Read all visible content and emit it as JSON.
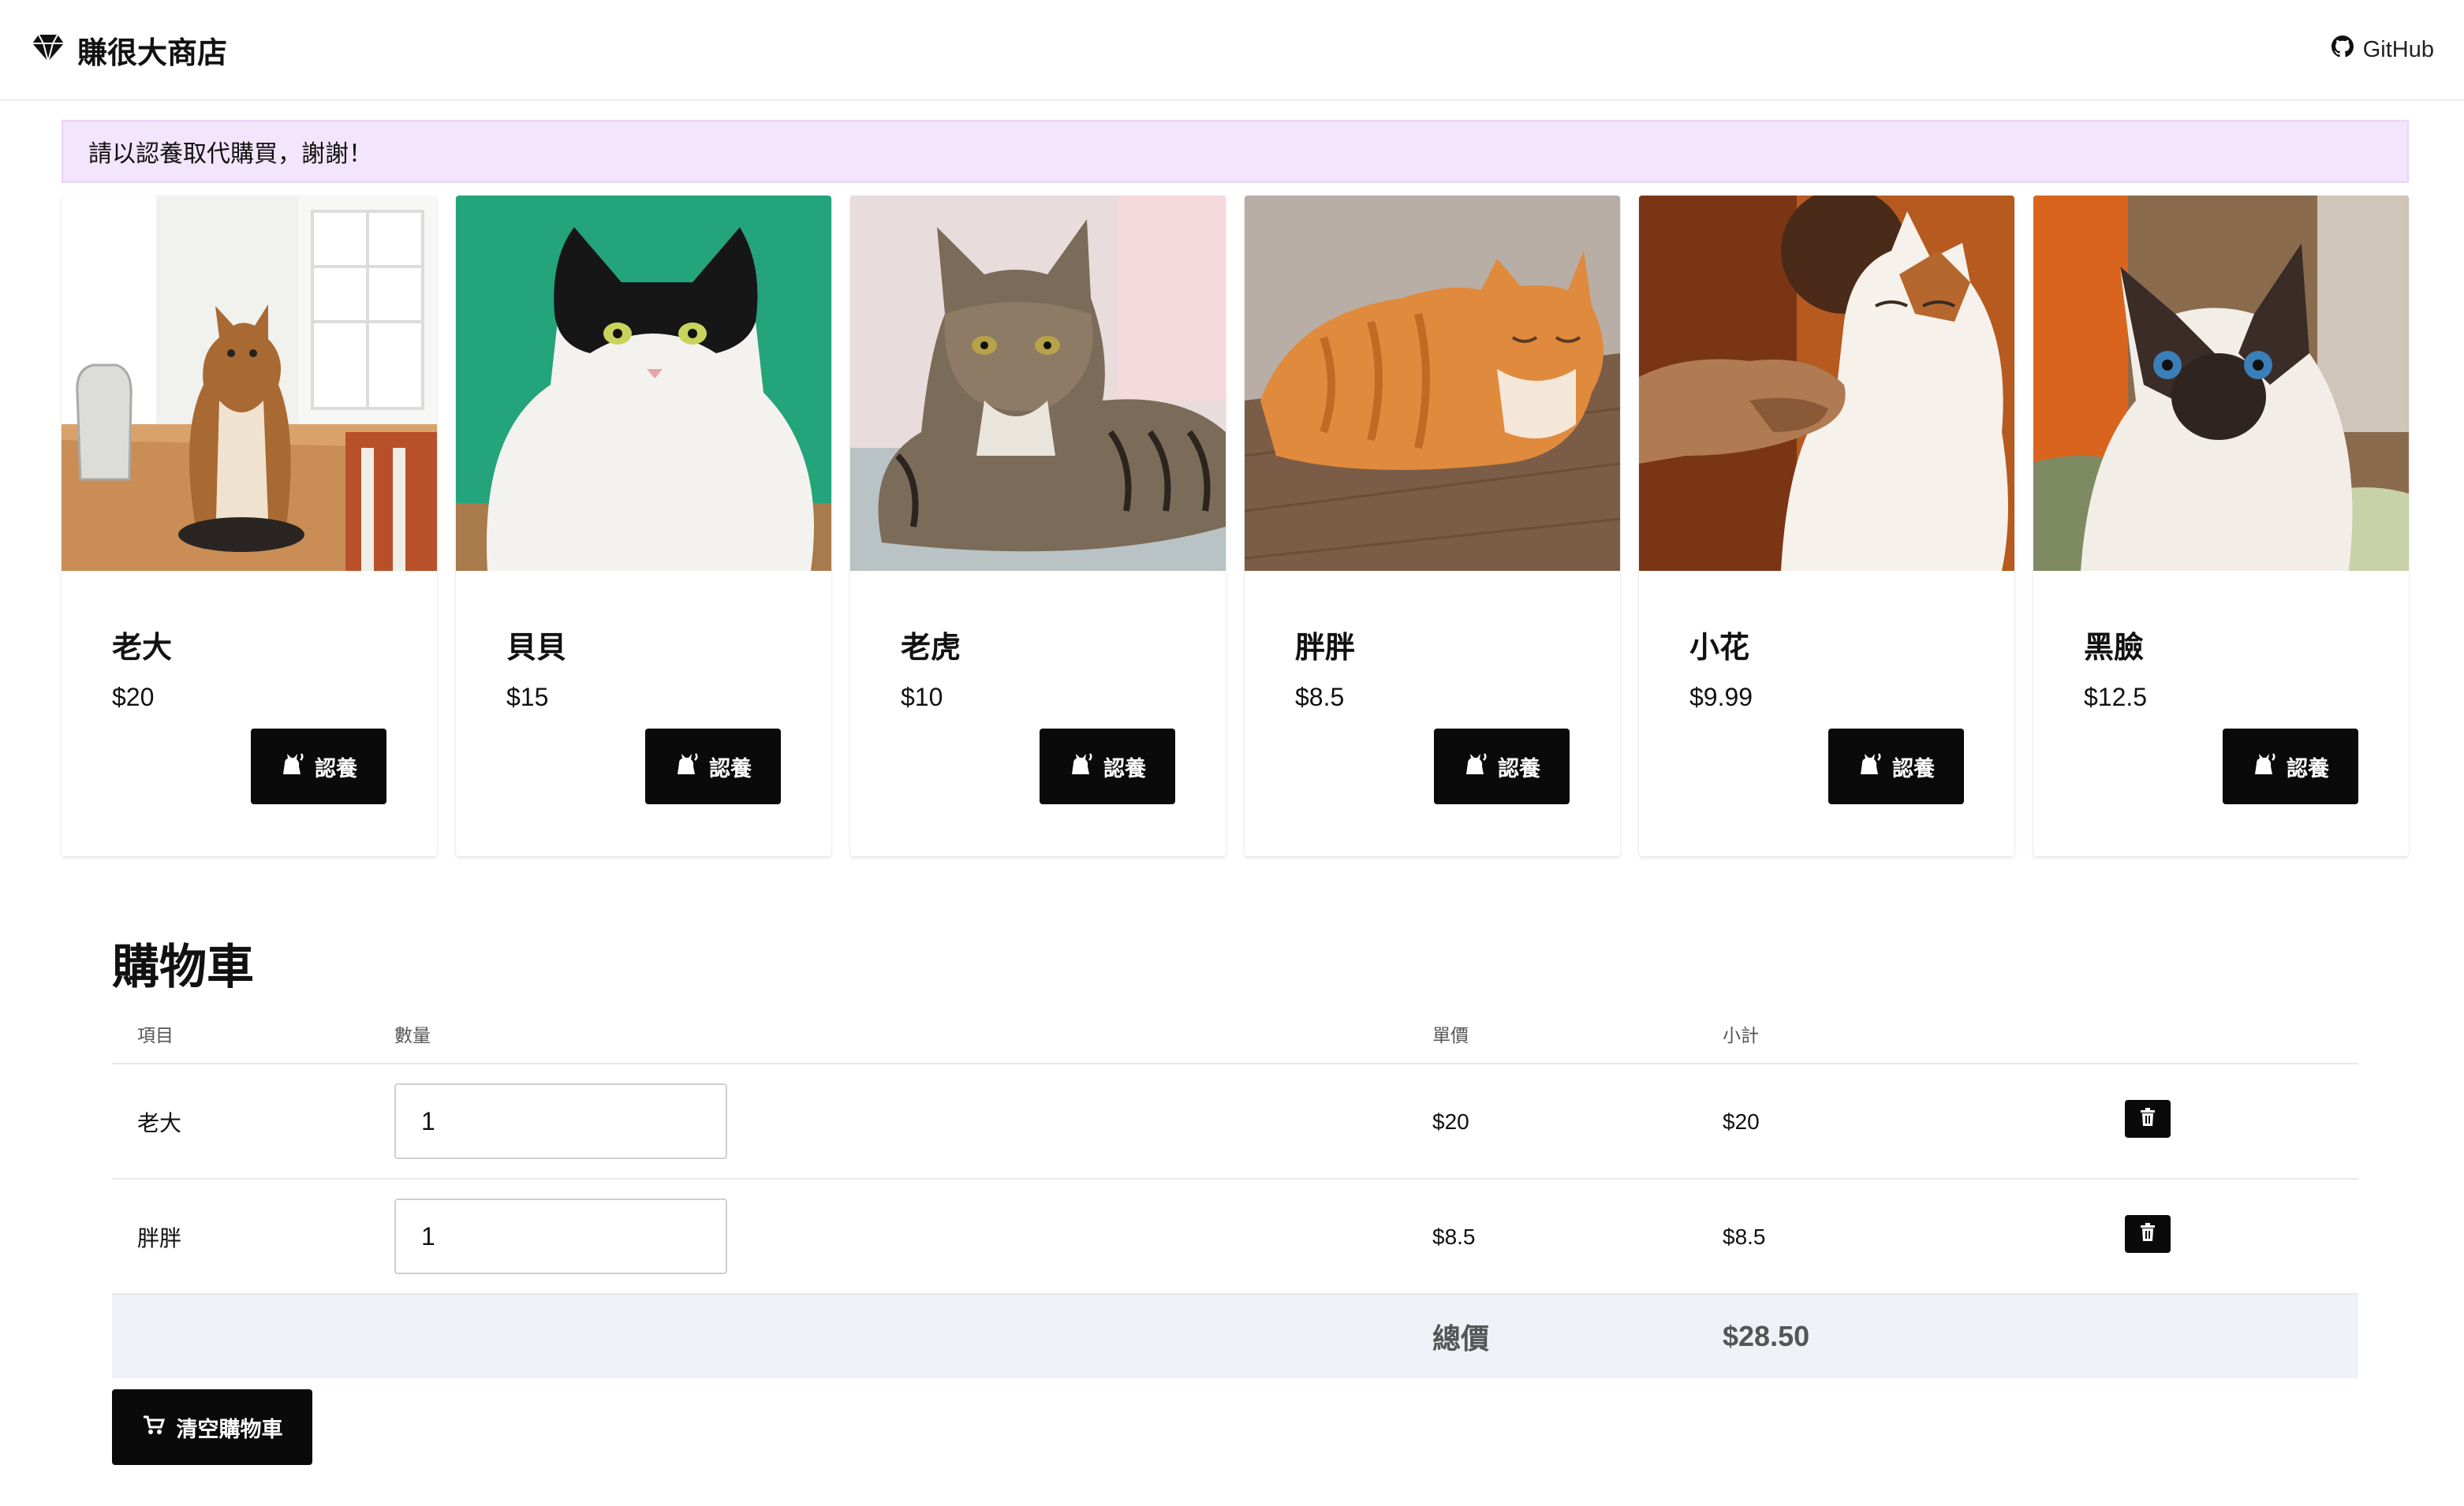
{
  "navbar": {
    "brand": "賺很大商店",
    "brand_icon": "diamond-icon",
    "github_label": "GitHub",
    "github_icon": "github-icon"
  },
  "notice": "請以認養取代購買，謝謝！",
  "products": [
    {
      "name": "老大",
      "price": "$20",
      "button": "認養",
      "photo": "tabby-cat-sitting-on-table"
    },
    {
      "name": "貝貝",
      "price": "$15",
      "button": "認養",
      "photo": "black-white-cat-on-green-background"
    },
    {
      "name": "老虎",
      "price": "$10",
      "button": "認養",
      "photo": "tabby-cat-lying-down"
    },
    {
      "name": "胖胖",
      "price": "$8.5",
      "button": "認養",
      "photo": "orange-cat-sleeping-on-floor"
    },
    {
      "name": "小花",
      "price": "$9.99",
      "button": "認養",
      "photo": "calico-cat-being-petted"
    },
    {
      "name": "黑臉",
      "price": "$12.5",
      "button": "認養",
      "photo": "siamese-kitten-blue-eyes"
    }
  ],
  "cart": {
    "title": "購物車",
    "columns": {
      "item": "項目",
      "quantity": "數量",
      "unit_price": "單價",
      "subtotal": "小計"
    },
    "rows": [
      {
        "item": "老大",
        "quantity": "1",
        "unit_price": "$20",
        "subtotal": "$20"
      },
      {
        "item": "胖胖",
        "quantity": "1",
        "unit_price": "$8.5",
        "subtotal": "$8.5"
      }
    ],
    "total_label": "總價",
    "total_value": "$28.50",
    "clear_button": "清空購物車"
  },
  "colors": {
    "notice_bg": "#f3e5fb",
    "button_bg": "#0a0a0a",
    "total_row_bg": "#eef2f8"
  }
}
